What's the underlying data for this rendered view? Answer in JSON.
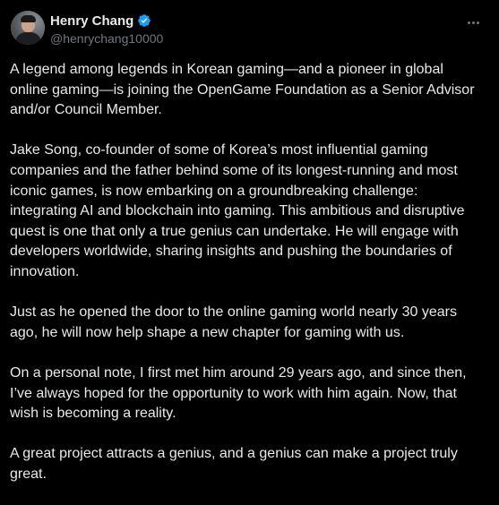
{
  "author": {
    "display_name": "Henry Chang",
    "handle": "@henrychang10000",
    "verified": true
  },
  "icons": {
    "verified": "verified-badge-icon",
    "more": "more-horizontal-icon",
    "avatar": "avatar"
  },
  "colors": {
    "background": "#000000",
    "text_primary": "#e7e9ea",
    "text_secondary": "#71767b",
    "verified_blue": "#1d9bf0"
  },
  "post": {
    "paragraphs": [
      "A legend among legends in Korean gaming—and a pioneer in global online gaming—is joining the OpenGame Foundation as a Senior Advisor and/or Council Member.",
      "Jake Song, co-founder of some of Korea’s most influential gaming companies and the father behind some of its longest-running and most iconic games, is now embarking on a groundbreaking challenge: integrating AI and blockchain into gaming. This ambitious and disruptive quest is one that only a true genius can undertake. He will engage with developers worldwide, sharing insights and pushing the boundaries of innovation.",
      "Just as he opened the door to the online gaming world nearly 30 years ago, he will now help shape a new chapter for gaming with us.",
      "On a personal note, I first met him around 29 years ago, and since then, I’ve always hoped for the opportunity to work with him again. Now, that wish is becoming a reality.",
      "A great project attracts a genius, and a genius can make a project truly great."
    ]
  }
}
